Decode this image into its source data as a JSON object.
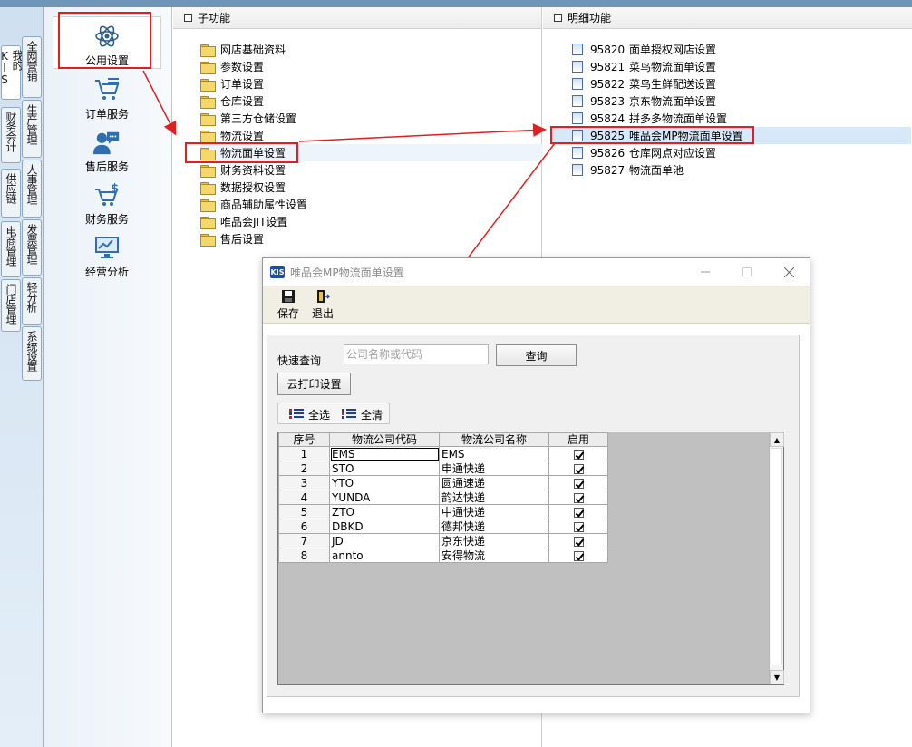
{
  "vtabs": [
    {
      "label": "我的KIS"
    },
    {
      "label": "全网营销"
    },
    {
      "label": "财务会计"
    },
    {
      "label": "生产管理"
    },
    {
      "label": "供应链"
    },
    {
      "label": "人事管理"
    },
    {
      "label": "电商管理"
    },
    {
      "label": "发票管理"
    },
    {
      "label": "门店管理"
    },
    {
      "label": "轻分析"
    },
    {
      "label": "系统设置"
    }
  ],
  "sidebar": {
    "items": [
      {
        "label": "公用设置",
        "icon": "atom-icon"
      },
      {
        "label": "订单服务",
        "icon": "cart-list-icon"
      },
      {
        "label": "售后服务",
        "icon": "support-person-icon"
      },
      {
        "label": "财务服务",
        "icon": "cart-dollar-icon"
      },
      {
        "label": "经营分析",
        "icon": "chart-monitor-icon"
      }
    ]
  },
  "sub_panel": {
    "title": "子功能",
    "items": [
      "网店基础资料",
      "参数设置",
      "订单设置",
      "仓库设置",
      "第三方仓储设置",
      "物流设置",
      "物流面单设置",
      "财务资料设置",
      "数据授权设置",
      "商品辅助属性设置",
      "唯品会JIT设置",
      "售后设置"
    ]
  },
  "detail_panel": {
    "title": "明细功能",
    "items": [
      {
        "code": "95820",
        "name": "面单授权网店设置"
      },
      {
        "code": "95821",
        "name": "菜鸟物流面单设置"
      },
      {
        "code": "95822",
        "name": "菜鸟生鲜配送设置"
      },
      {
        "code": "95823",
        "name": "京东物流面单设置"
      },
      {
        "code": "95824",
        "name": "拼多多物流面单设置"
      },
      {
        "code": "95825",
        "name": "唯品会MP物流面单设置"
      },
      {
        "code": "95826",
        "name": "仓库网点对应设置"
      },
      {
        "code": "95827",
        "name": "物流面单池"
      }
    ]
  },
  "dialog": {
    "logo": "KIS",
    "title": "唯品会MP物流面单设置",
    "toolbar": {
      "save": "保存",
      "exit": "退出"
    },
    "quick_label": "快速查询",
    "search_placeholder": "公司名称或代码",
    "search_value": "",
    "query_btn": "查询",
    "cloud_btn": "云打印设置",
    "select_all": "全选",
    "clear_all": "全清",
    "columns": [
      "序号",
      "物流公司代码",
      "物流公司名称",
      "启用"
    ],
    "rows": [
      {
        "no": "1",
        "code": "EMS",
        "name": "EMS",
        "enabled": true
      },
      {
        "no": "2",
        "code": "STO",
        "name": "申通快递",
        "enabled": true
      },
      {
        "no": "3",
        "code": "YTO",
        "name": "圆通速递",
        "enabled": true
      },
      {
        "no": "4",
        "code": "YUNDA",
        "name": "韵达快递",
        "enabled": true
      },
      {
        "no": "5",
        "code": "ZTO",
        "name": "中通快递",
        "enabled": true
      },
      {
        "no": "6",
        "code": "DBKD",
        "name": "德邦快递",
        "enabled": true
      },
      {
        "no": "7",
        "code": "JD",
        "name": "京东快递",
        "enabled": true
      },
      {
        "no": "8",
        "code": "annto",
        "name": "安得物流",
        "enabled": true
      }
    ]
  },
  "colors": {
    "highlight_red": "#e02020",
    "selected_row": "#d7e8f8"
  }
}
